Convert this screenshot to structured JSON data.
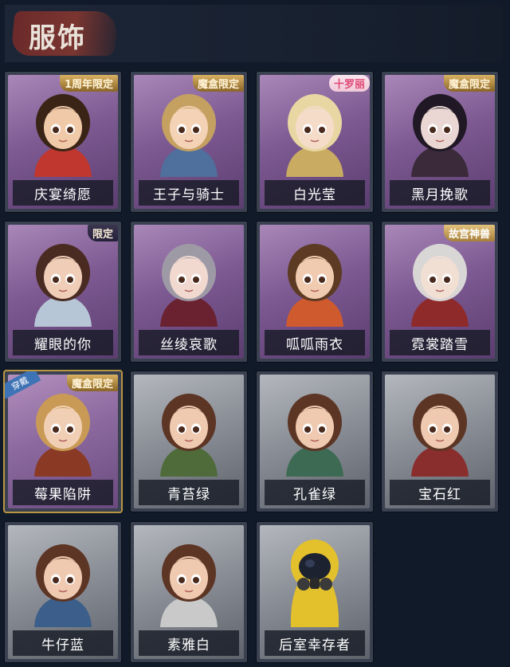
{
  "header": {
    "title": "服饰"
  },
  "items": [
    {
      "name": "庆宴绮愿",
      "badge": "1周年限定",
      "badge_style": "gold",
      "style": "purple"
    },
    {
      "name": "王子与骑士",
      "badge": "魔盒限定",
      "badge_style": "gold",
      "style": "purple"
    },
    {
      "name": "白光莹",
      "badge": "十罗丽",
      "badge_style": "pink",
      "style": "purple"
    },
    {
      "name": "黑月挽歌",
      "badge": "魔盒限定",
      "badge_style": "gold",
      "style": "purple"
    },
    {
      "name": "耀眼的你",
      "badge": "限定",
      "badge_style": "dark",
      "style": "purple"
    },
    {
      "name": "丝绫哀歌",
      "badge": "",
      "badge_style": "",
      "style": "purple"
    },
    {
      "name": "呱呱雨衣",
      "badge": "",
      "badge_style": "",
      "style": "purple"
    },
    {
      "name": "霓裳踏雪",
      "badge": "故宫神兽",
      "badge_style": "gold2",
      "style": "purple"
    },
    {
      "name": "莓果陷阱",
      "badge": "魔盒限定",
      "badge_style": "gold",
      "style": "yellow-edge",
      "wearing": "穿戴"
    },
    {
      "name": "青苔绿",
      "badge": "",
      "badge_style": "",
      "style": "gray"
    },
    {
      "name": "孔雀绿",
      "badge": "",
      "badge_style": "",
      "style": "gray"
    },
    {
      "name": "宝石红",
      "badge": "",
      "badge_style": "",
      "style": "gray"
    },
    {
      "name": "牛仔蓝",
      "badge": "",
      "badge_style": "",
      "style": "gray"
    },
    {
      "name": "素雅白",
      "badge": "",
      "badge_style": "",
      "style": "gray"
    },
    {
      "name": "后室幸存者",
      "badge": "",
      "badge_style": "",
      "style": "gray"
    }
  ],
  "colors": {
    "background": "#111a28",
    "purple_card": "#7d5a92",
    "gray_card": "#8b8f97",
    "equipped_border": "#b99542"
  }
}
